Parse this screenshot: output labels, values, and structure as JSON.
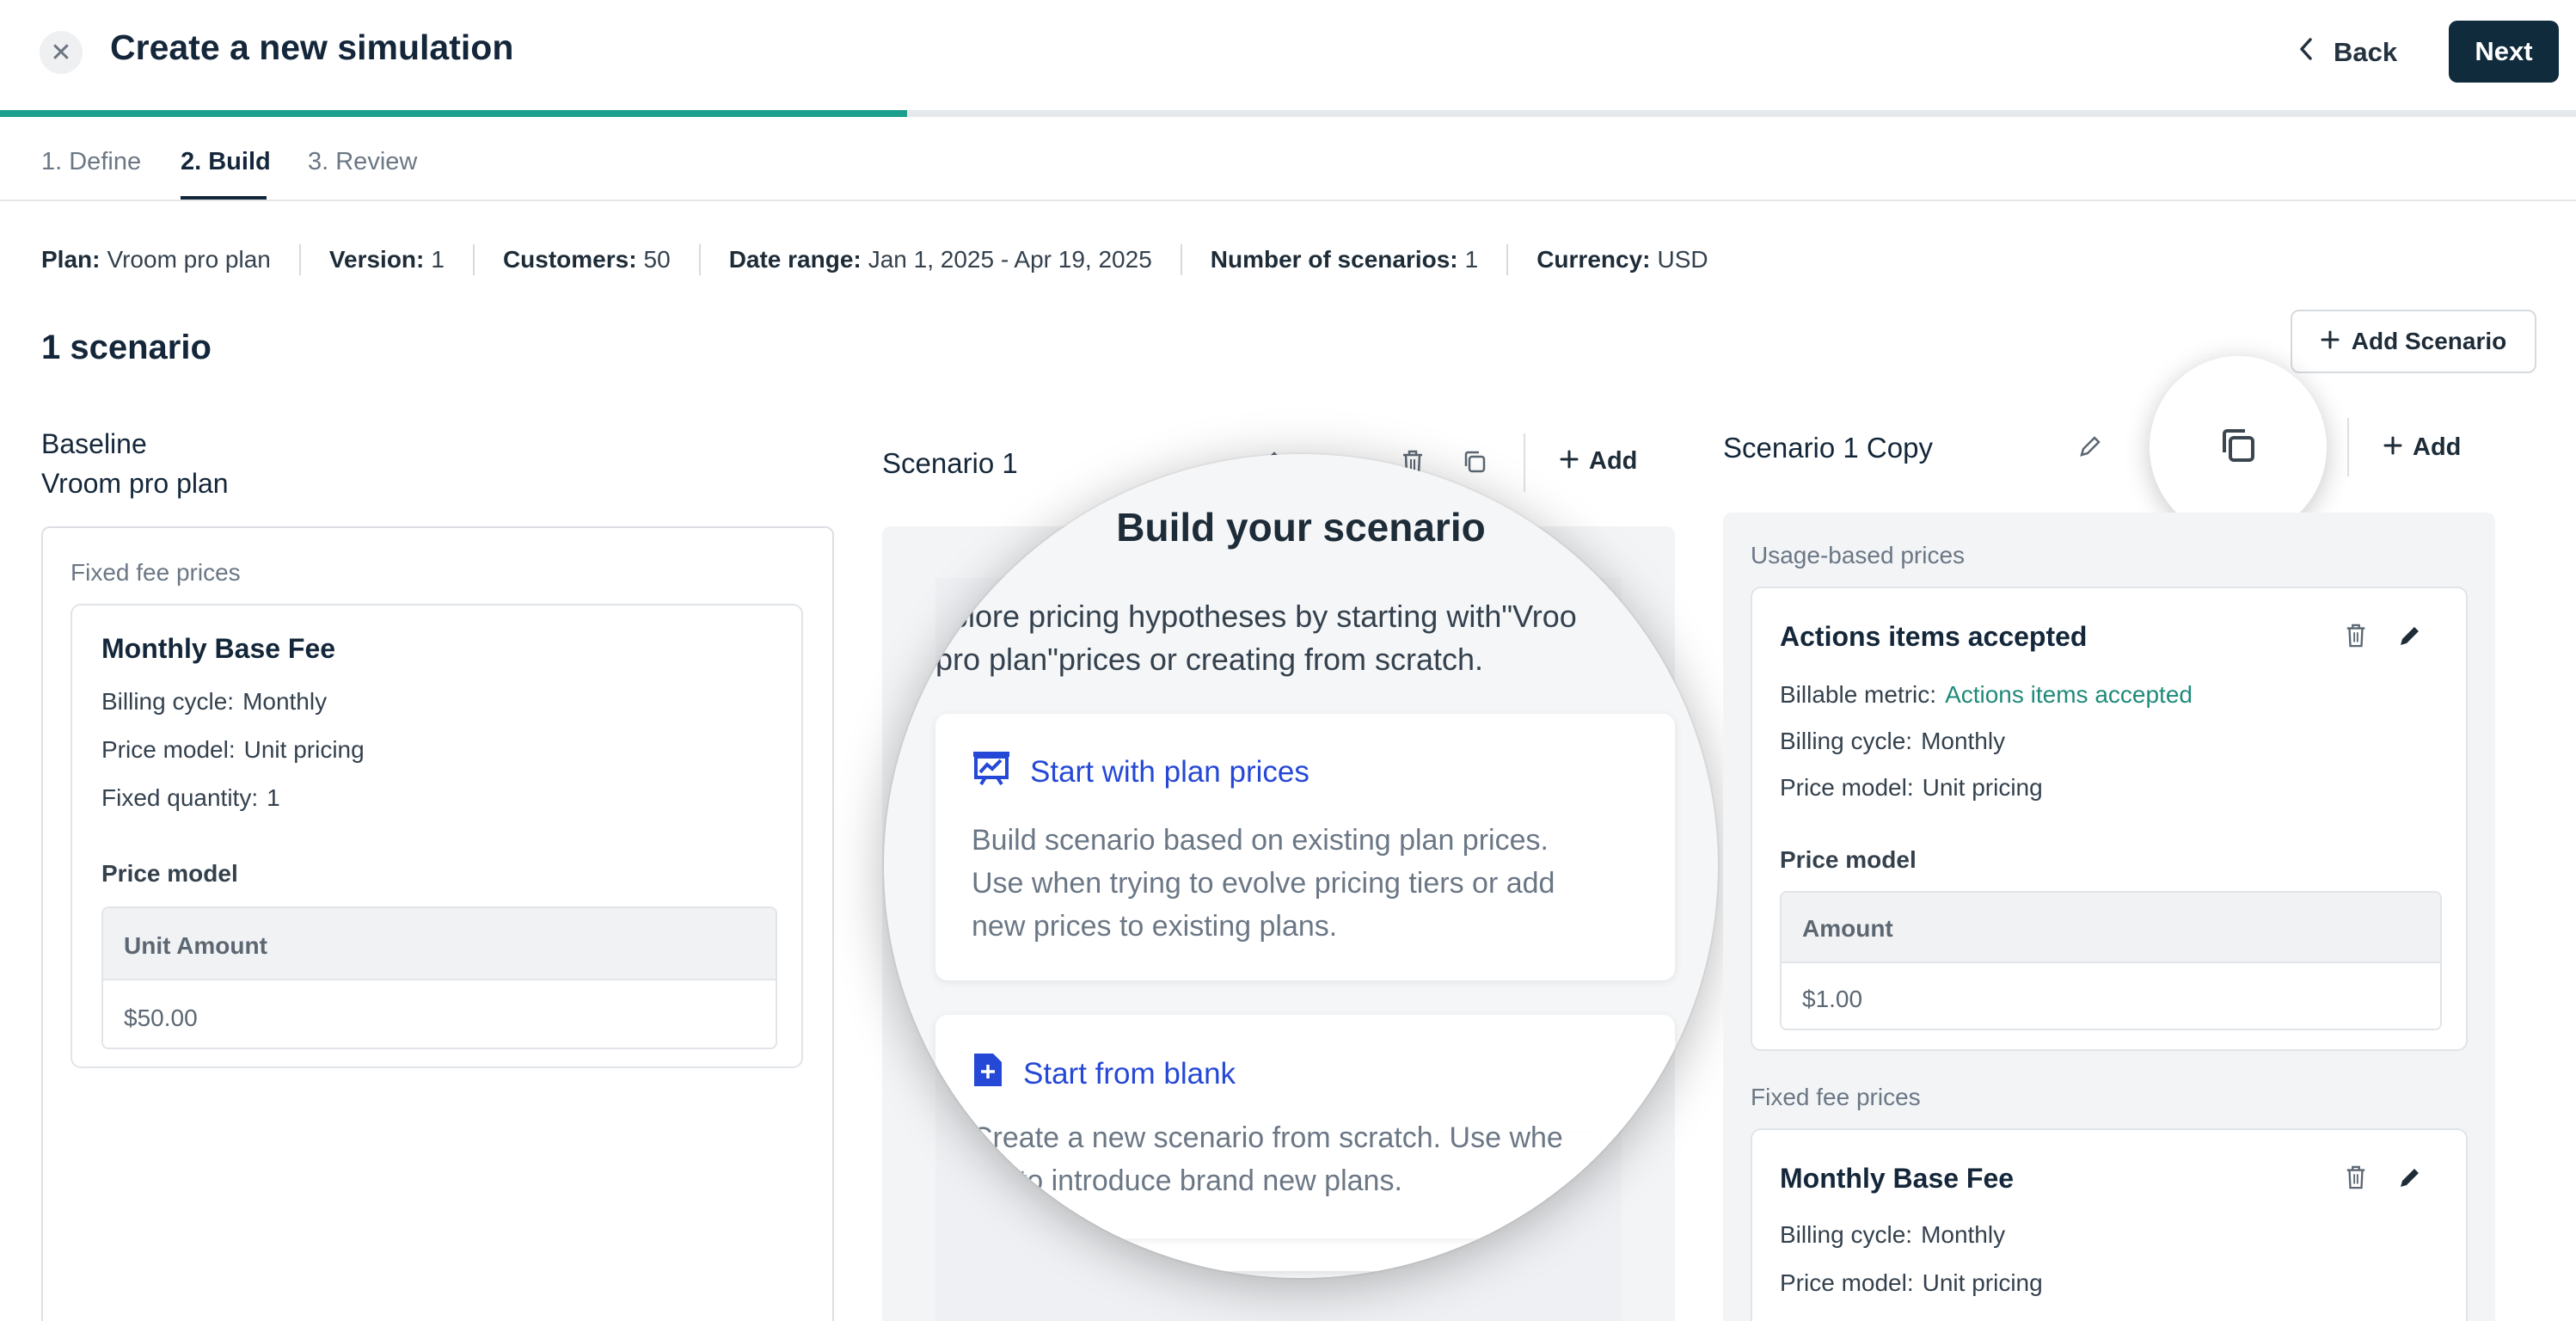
{
  "header": {
    "title": "Create a new simulation",
    "back_label": "Back",
    "next_label": "Next",
    "close_icon": "close-icon",
    "progress_fraction": 0.352
  },
  "steps": [
    {
      "label": "1. Define"
    },
    {
      "label": "2. Build"
    },
    {
      "label": "3. Review"
    }
  ],
  "info": {
    "plan_key": "Plan:",
    "plan_val": "Vroom pro plan",
    "version_key": "Version:",
    "version_val": "1",
    "customers_key": "Customers:",
    "customers_val": "50",
    "date_key": "Date range:",
    "date_val": "Jan 1, 2025 - Apr 19, 2025",
    "scenarios_key": "Number of scenarios:",
    "scenarios_val": "1",
    "currency_key": "Currency:",
    "currency_val": "USD"
  },
  "scenario_count": "1 scenario",
  "add_scenario_label": "Add Scenario",
  "baseline": {
    "label": "Baseline",
    "plan": "Vroom pro plan",
    "section": "Fixed fee prices",
    "card": {
      "title": "Monthly Base Fee",
      "billing_key": "Billing cycle:",
      "billing_val": "Monthly",
      "model_key": "Price model:",
      "model_val": "Unit pricing",
      "qty_key": "Fixed quantity:",
      "qty_val": "1",
      "price_model_label": "Price model",
      "table_head": "Unit Amount",
      "table_val": "$50.00"
    }
  },
  "scenario1": {
    "title": "Scenario 1",
    "add_label": "Add",
    "magnifier": {
      "title": "Build your scenario",
      "desc_line1": "xplore pricing hypotheses by starting with\"Vroo",
      "desc_line2": "pro plan\"prices or creating from scratch.",
      "option1_title": "Start with plan prices",
      "option1_line1": "Build scenario based on existing plan prices.",
      "option1_line2": "Use when trying to evolve pricing tiers or add",
      "option1_line3": "new prices to existing plans.",
      "option2_title": "Start from blank",
      "option2_line1": "Create a new scenario from scratch. Use whe",
      "option2_line2": "ing to introduce brand new plans.",
      "under_text1": "C",
      "under_text2": "trying"
    }
  },
  "scenario_copy": {
    "title": "Scenario 1 Copy",
    "add_label": "Add",
    "usage_section": "Usage-based prices",
    "usage_card": {
      "title": "Actions items accepted",
      "metric_key": "Billable metric:",
      "metric_val": "Actions items accepted",
      "billing_key": "Billing cycle:",
      "billing_val": "Monthly",
      "model_key": "Price model:",
      "model_val": "Unit pricing",
      "price_model_label": "Price model",
      "table_head": "Amount",
      "table_val": "$1.00"
    },
    "fixed_section": "Fixed fee prices",
    "fixed_card": {
      "title": "Monthly Base Fee",
      "billing_key": "Billing cycle:",
      "billing_val": "Monthly",
      "model_key": "Price model:",
      "model_val": "Unit pricing"
    }
  },
  "colors": {
    "accent_teal": "#1c9e8c",
    "primary_dark": "#0f2b3c",
    "link_blue": "#2548d6"
  }
}
